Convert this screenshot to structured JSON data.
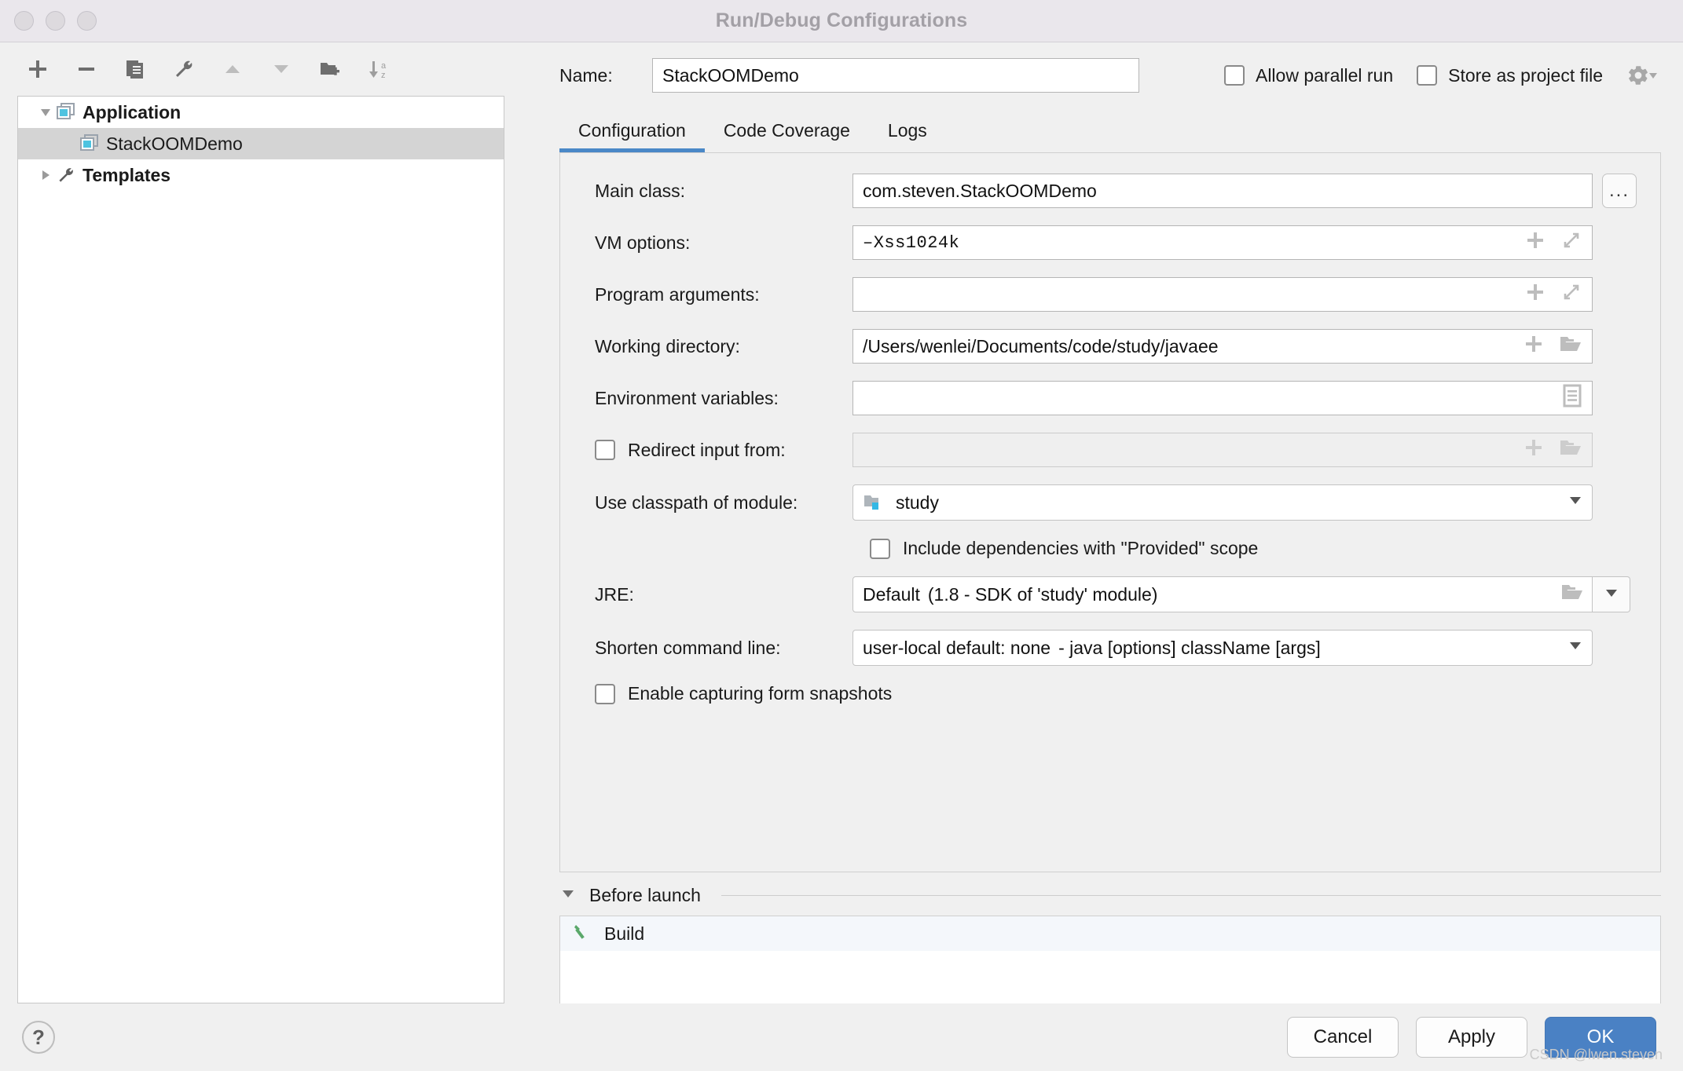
{
  "window": {
    "title": "Run/Debug Configurations"
  },
  "toolbar": {
    "buttons": [
      {
        "name": "add",
        "icon": "plus-icon"
      },
      {
        "name": "remove",
        "icon": "minus-icon"
      },
      {
        "name": "copy",
        "icon": "copy-icon"
      },
      {
        "name": "edit-templates",
        "icon": "wrench-icon"
      },
      {
        "name": "move-up",
        "icon": "triangle-up-icon"
      },
      {
        "name": "move-down",
        "icon": "triangle-down-icon"
      },
      {
        "name": "new-folder",
        "icon": "folder-add-icon"
      },
      {
        "name": "sort-alphabetically",
        "icon": "sort-az-icon"
      }
    ]
  },
  "tree": {
    "nodes": [
      {
        "label": "Application",
        "expanded": true,
        "icon": "application-icon",
        "selected": false
      },
      {
        "label": "StackOOMDemo",
        "child": true,
        "icon": "application-icon",
        "selected": true
      },
      {
        "label": "Templates",
        "expanded": false,
        "icon": "wrench-icon",
        "selected": false
      }
    ]
  },
  "name_row": {
    "label": "Name:",
    "value": "StackOOMDemo",
    "placeholder": "",
    "allow_parallel_run": {
      "label": "Allow parallel run",
      "checked": false
    },
    "store_as_project_file": {
      "label": "Store as project file",
      "checked": false
    },
    "gear_icon": "gear-icon"
  },
  "tabs": [
    {
      "label": "Configuration",
      "active": true
    },
    {
      "label": "Code Coverage",
      "active": false
    },
    {
      "label": "Logs",
      "active": false
    }
  ],
  "form": {
    "main_class": {
      "label": "Main class:",
      "value": "com.steven.StackOOMDemo",
      "browse_label": "...",
      "browse_icon": "ellipsis-icon"
    },
    "vm_options": {
      "label": "VM options:",
      "value": "–Xss1024k",
      "icons": [
        "plus-icon",
        "expand-icon"
      ]
    },
    "program_arguments": {
      "label": "Program arguments:",
      "value": "",
      "icons": [
        "plus-icon",
        "expand-icon"
      ]
    },
    "working_directory": {
      "label": "Working directory:",
      "value": "/Users/wenlei/Documents/code/study/javaee",
      "icons": [
        "plus-icon",
        "folder-icon"
      ]
    },
    "environment_variables": {
      "label": "Environment variables:",
      "value": "",
      "icons": [
        "list-icon"
      ]
    },
    "redirect_input": {
      "label": "Redirect input from:",
      "checked": false,
      "value": "",
      "icons": [
        "plus-icon",
        "folder-icon"
      ]
    },
    "classpath_module": {
      "label": "Use classpath of module:",
      "value": "study",
      "icon": "module-folder-icon",
      "caret_icon": "chevron-down-icon"
    },
    "include_provided": {
      "label": "Include dependencies with \"Provided\" scope",
      "checked": false
    },
    "jre": {
      "label": "JRE:",
      "value": "Default",
      "detail": "(1.8 - SDK of 'study' module)",
      "folder_icon": "folder-icon",
      "caret_icon": "chevron-down-icon"
    },
    "shorten_command_line": {
      "label": "Shorten command line:",
      "value": "user-local default: none",
      "detail": "- java [options] className [args]",
      "caret_icon": "chevron-down-icon"
    },
    "form_snapshots": {
      "label": "Enable capturing form snapshots",
      "checked": false
    }
  },
  "before_launch": {
    "title": "Before launch",
    "expanded": true,
    "items": [
      {
        "label": "Build",
        "icon": "build-hammer-icon"
      }
    ]
  },
  "footer": {
    "help_label": "?",
    "cancel_label": "Cancel",
    "apply_label": "Apply",
    "ok_label": "OK"
  },
  "watermark": "CSDN @lwen.steven",
  "colors": {
    "accent": "#4a88c7",
    "ok_button": "#4a81c4",
    "selection": "#d4d4d4",
    "titlebar": "#eae7ec"
  }
}
